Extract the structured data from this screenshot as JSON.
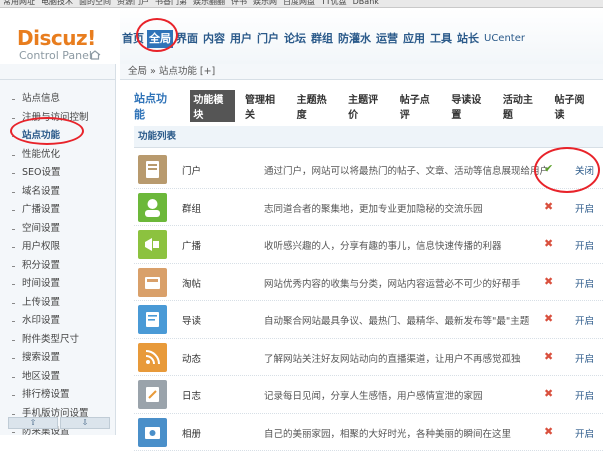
{
  "bookmarks": [
    "常用网址",
    "电脑技术",
    "面的空间",
    "资源门户",
    "书香门第",
    "娱乐翻翻",
    "评书",
    "娱乐网",
    "百度网盘",
    "TT优盘",
    "DBank"
  ],
  "logo": {
    "title": "Discuz!",
    "subtitle": "Control Panel"
  },
  "topnav": {
    "tabs": [
      {
        "label": "首页",
        "active": false
      },
      {
        "label": "全局",
        "active": true
      },
      {
        "label": "界面",
        "active": false
      },
      {
        "label": "内容",
        "active": false
      },
      {
        "label": "用户",
        "active": false
      },
      {
        "label": "门户",
        "active": false
      },
      {
        "label": "论坛",
        "active": false
      },
      {
        "label": "群组",
        "active": false
      },
      {
        "label": "防灌水",
        "active": false
      },
      {
        "label": "运营",
        "active": false
      },
      {
        "label": "应用",
        "active": false
      },
      {
        "label": "工具",
        "active": false
      },
      {
        "label": "站长",
        "active": false
      },
      {
        "label": "UCenter",
        "active": false
      }
    ]
  },
  "breadcrumb": "全局 » 站点功能 [+]",
  "sidebar": {
    "items": [
      {
        "label": "站点信息",
        "active": false
      },
      {
        "label": "注册与访问控制",
        "active": false
      },
      {
        "label": "站点功能",
        "active": true
      },
      {
        "label": "性能优化",
        "active": false
      },
      {
        "label": "SEO设置",
        "active": false
      },
      {
        "label": "域名设置",
        "active": false
      },
      {
        "label": "广播设置",
        "active": false
      },
      {
        "label": "空间设置",
        "active": false
      },
      {
        "label": "用户权限",
        "active": false
      },
      {
        "label": "积分设置",
        "active": false
      },
      {
        "label": "时间设置",
        "active": false
      },
      {
        "label": "上传设置",
        "active": false
      },
      {
        "label": "水印设置",
        "active": false
      },
      {
        "label": "附件类型尺寸",
        "active": false
      },
      {
        "label": "搜索设置",
        "active": false
      },
      {
        "label": "地区设置",
        "active": false
      },
      {
        "label": "排行榜设置",
        "active": false
      },
      {
        "label": "手机版访问设置",
        "active": false
      },
      {
        "label": "防采集设置",
        "active": false
      }
    ],
    "scroll_up": "⇧",
    "scroll_down": "⇩"
  },
  "main": {
    "title": "站点功能",
    "subtabs": [
      {
        "label": "功能模块",
        "active": true
      },
      {
        "label": "管理相关",
        "active": false
      },
      {
        "label": "主题热度",
        "active": false
      },
      {
        "label": "主题评价",
        "active": false
      },
      {
        "label": "帖子点评",
        "active": false
      },
      {
        "label": "导读设置",
        "active": false
      },
      {
        "label": "活动主题",
        "active": false
      },
      {
        "label": "帖子阅读",
        "active": false
      }
    ],
    "list_header": "功能列表",
    "rows": [
      {
        "name": "门户",
        "desc": "通过门户，网站可以将最热门的帖子、文章、活动等信息展现给用户",
        "enabled": true,
        "status_icon": "check-icon",
        "action": "关闭",
        "icon": "portal-icon",
        "color": "#b89a6e"
      },
      {
        "name": "群组",
        "desc": "志同道合者的聚集地，更加专业更加隐秘的交流乐园",
        "enabled": false,
        "status_icon": "cross-icon",
        "action": "开启",
        "icon": "group-icon",
        "color": "#6cb83a"
      },
      {
        "name": "广播",
        "desc": "收听感兴趣的人，分享有趣的事儿，信息快速传播的利器",
        "enabled": false,
        "status_icon": "cross-icon",
        "action": "开启",
        "icon": "broadcast-icon",
        "color": "#8cc23f"
      },
      {
        "name": "淘帖",
        "desc": "网站优秀内容的收集与分类，网站内容运营必不可少的好帮手",
        "enabled": false,
        "status_icon": "cross-icon",
        "action": "开启",
        "icon": "collection-icon",
        "color": "#d9a06a"
      },
      {
        "name": "导读",
        "desc": "自动聚合网站最具争议、最热门、最精华、最新发布等\"最\"主题",
        "enabled": false,
        "status_icon": "cross-icon",
        "action": "开启",
        "icon": "guide-icon",
        "color": "#4a9ad6"
      },
      {
        "name": "动态",
        "desc": "了解网站关注好友网站动向的直播渠道，让用户不再感觉孤独",
        "enabled": false,
        "status_icon": "cross-icon",
        "action": "开启",
        "icon": "feed-icon",
        "color": "#e89a3a"
      },
      {
        "name": "日志",
        "desc": "记录每日见闻，分享人生感悟，用户感情宣泄的家园",
        "enabled": false,
        "status_icon": "cross-icon",
        "action": "开启",
        "icon": "blog-icon",
        "color": "#9aa3ab"
      },
      {
        "name": "相册",
        "desc": "自己的美丽家园，相聚的大好时光，各种美丽的瞬间在这里",
        "enabled": false,
        "status_icon": "cross-icon",
        "action": "开启",
        "icon": "album-icon",
        "color": "#4a8fc9"
      }
    ]
  },
  "annotations": [
    "red-circle-global-tab",
    "red-circle-site-function",
    "red-circle-portal-status"
  ],
  "colors": {
    "accent": "#2f73b8",
    "brand": "#e87d1e",
    "annotation": "#e8232a"
  }
}
